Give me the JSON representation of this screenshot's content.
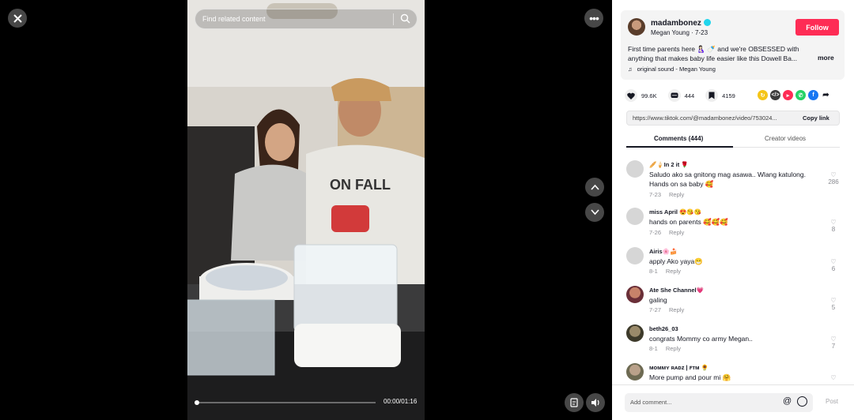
{
  "player": {
    "search_placeholder": "Find related content",
    "time": "00:00/01:16"
  },
  "post": {
    "username": "madambonez",
    "subline": "Megan Young · 7-23",
    "follow_label": "Follow",
    "description": "First time parents here 🤱🏻 🍼 and we're OBSESSED with anything that makes baby life easier like this Dowell Ba...",
    "more_label": "more",
    "sound": "original sound - Megan Young",
    "likes": "99.6K",
    "comments_count": "444",
    "saves": "4159",
    "link": "https://www.tiktok.com/@madambonez/video/753024...",
    "copy_label": "Copy link"
  },
  "tabs": {
    "comments": "Comments (444)",
    "creator": "Creator videos"
  },
  "comments": [
    {
      "name": "🥖🍦In 2 it 🌹",
      "text": "Saludo ako sa gnitong mag asawa.. Wlang katulong. Hands on sa baby 🥰",
      "date": "7-23",
      "reply": "Reply",
      "likes": "286"
    },
    {
      "name": "miss April 😍😘😘",
      "text": "hands on parents 🥰🥰🥰",
      "date": "7-26",
      "reply": "Reply",
      "likes": "8"
    },
    {
      "name": "Airis🌸🍰",
      "text": "apply Ako yaya😁",
      "date": "8-1",
      "reply": "Reply",
      "likes": "6"
    },
    {
      "name": "Ate She Channel💗",
      "text": "galing",
      "date": "7-27",
      "reply": "Reply",
      "likes": "5"
    },
    {
      "name": "beth26_03",
      "text": "congrats Mommy co army Megan..",
      "date": "8-1",
      "reply": "Reply",
      "likes": "7"
    },
    {
      "name": "ᴍᴏᴍᴍʏ ʀᴀᴅᴢ | ꜰᴛᴍ 🌻",
      "text": "More pump and pour mi 🤗",
      "date": "",
      "reply": "",
      "likes": ""
    }
  ],
  "composer": {
    "placeholder": "Add comment...",
    "at": "@",
    "post_label": "Post"
  },
  "colors": {
    "accent": "#fe2c55",
    "panel_bg": "#ffffff",
    "player_bg": "#000000"
  },
  "icons": {
    "close": "close-icon",
    "more": "more-icon",
    "up": "chevron-up-icon",
    "down": "chevron-down-icon",
    "volume": "volume-icon",
    "caption": "caption-icon",
    "search": "search-icon",
    "heart": "heart-icon",
    "comment": "comment-icon",
    "bookmark": "bookmark-icon",
    "music": "music-note-icon"
  }
}
